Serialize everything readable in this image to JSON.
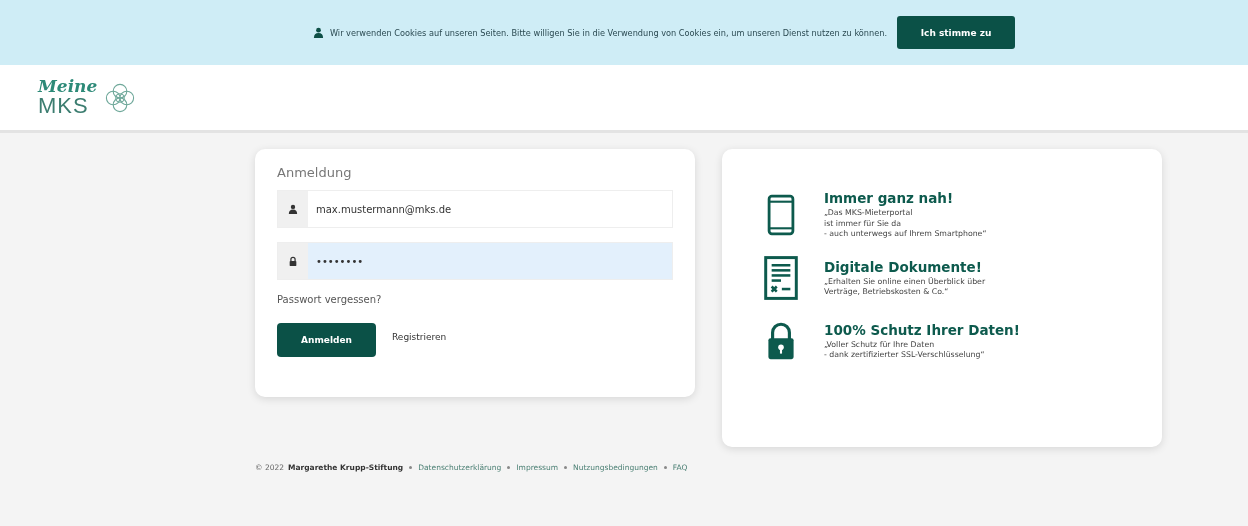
{
  "cookie_banner": {
    "text": "Wir verwenden Cookies auf unseren Seiten. Bitte willigen Sie in die Verwendung von Cookies ein, um unseren Dienst nutzen zu können.",
    "button": "Ich stimme zu"
  },
  "logo": {
    "line_1": "Meine",
    "line_2": "MKS"
  },
  "login": {
    "title": "Anmeldung",
    "fields": [
      {
        "kind": "user",
        "value": "max.mustermann@mks.de",
        "focused": false
      },
      {
        "kind": "lock",
        "value": "••••••••",
        "focused": true
      }
    ],
    "forgot_link": "Passwort vergessen?",
    "submit_button": "Anmelden",
    "register_link": "Registrieren"
  },
  "features": [
    {
      "kind": "phone",
      "title": "Immer ganz nah!",
      "lines": [
        "„Das MKS-Mieterportal",
        "ist immer für Sie da",
        "- auch unterwegs auf Ihrem Smartphone“"
      ]
    },
    {
      "kind": "document",
      "title": "Digitale Dokumente!",
      "lines": [
        "„Erhalten Sie online einen Überblick über",
        "Verträge, Betriebskosten & Co.“"
      ]
    },
    {
      "kind": "lock",
      "title": "100% Schutz Ihrer Daten!",
      "lines": [
        "„Voller Schutz für Ihre Daten",
        "- dank zertifizierter SSL-Verschlüsselung“"
      ]
    }
  ],
  "footer": {
    "copyright": "© 2022",
    "owner": "Margarethe Krupp-Stiftung",
    "links": [
      "Datenschutzerklärung",
      "Impressum",
      "Nutzungsbedingungen",
      "FAQ"
    ]
  }
}
